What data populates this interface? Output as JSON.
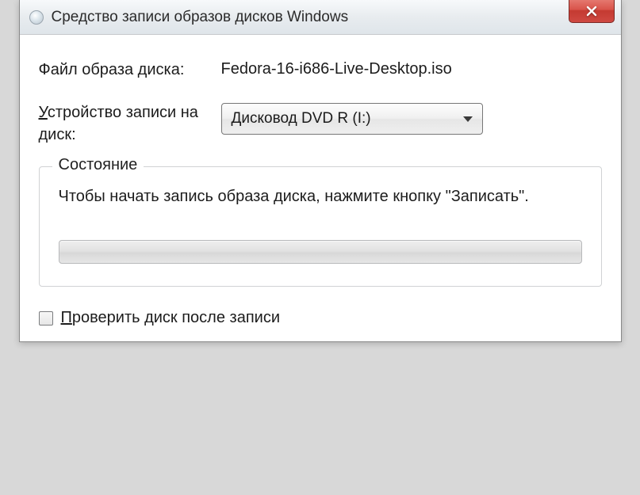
{
  "titlebar": {
    "title": "Средство записи образов дисков Windows"
  },
  "fields": {
    "image_file_label": "Файл образа диска:",
    "image_file_value": "Fedora-16-i686-Live-Desktop.iso",
    "burner_label_pre": "У",
    "burner_label_post": "стройство записи на диск:",
    "burner_value": "Дисковод DVD R (I:)"
  },
  "status": {
    "group_title": "Состояние",
    "text": "Чтобы начать запись образа диска, нажмите кнопку \"Записать\"."
  },
  "verify": {
    "label_pre": "П",
    "label_post": "роверить диск после записи"
  }
}
